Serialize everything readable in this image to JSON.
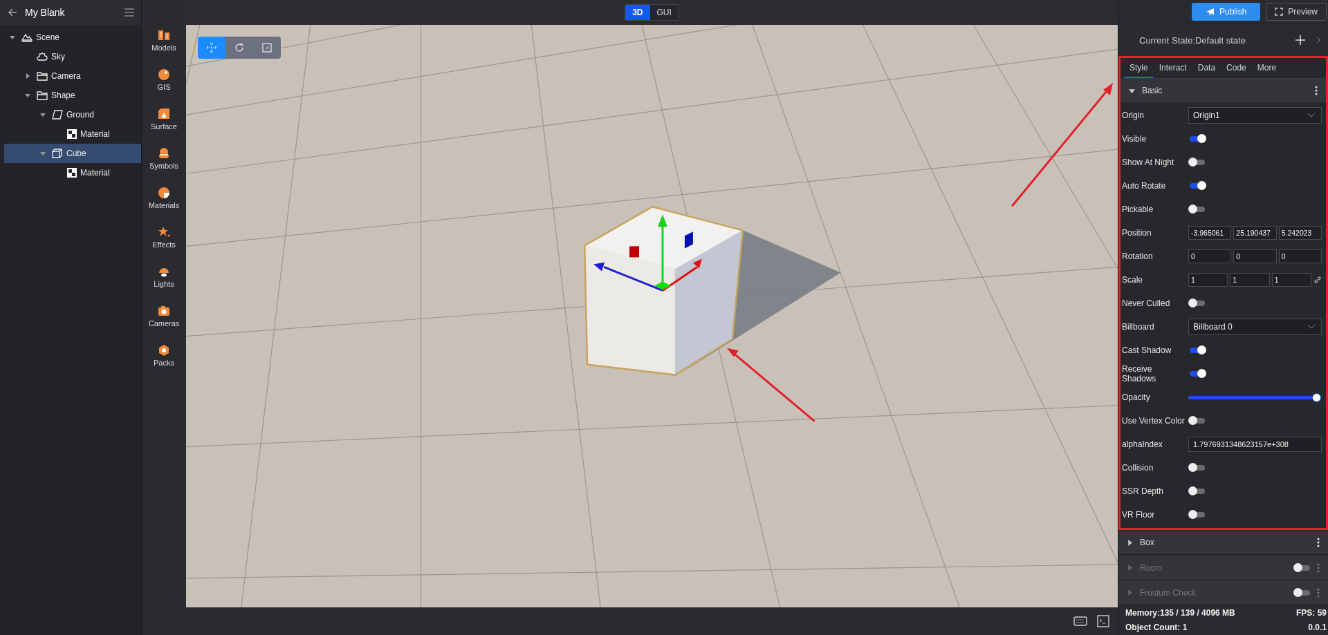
{
  "project": {
    "title": "My Blank"
  },
  "tree": [
    {
      "label": "Scene",
      "kind": "scene",
      "expanded": true,
      "selected": false,
      "children": [
        {
          "label": "Sky",
          "kind": "sky",
          "selected": false
        },
        {
          "label": "Camera",
          "kind": "folder",
          "expanded": false,
          "selected": false
        },
        {
          "label": "Shape",
          "kind": "folder",
          "expanded": true,
          "selected": false,
          "children": [
            {
              "label": "Ground",
              "kind": "plane",
              "expanded": true,
              "selected": false,
              "children": [
                {
                  "label": "Material",
                  "kind": "material",
                  "selected": false
                }
              ]
            },
            {
              "label": "Cube",
              "kind": "box",
              "expanded": true,
              "selected": true,
              "children": [
                {
                  "label": "Material",
                  "kind": "material",
                  "selected": false
                }
              ]
            }
          ]
        }
      ]
    }
  ],
  "library": [
    {
      "label": "Models"
    },
    {
      "label": "GIS"
    },
    {
      "label": "Surface"
    },
    {
      "label": "Symbols"
    },
    {
      "label": "Materials"
    },
    {
      "label": "Effects"
    },
    {
      "label": "Lights"
    },
    {
      "label": "Cameras"
    },
    {
      "label": "Packs"
    }
  ],
  "mode_switch": [
    {
      "label": "3D",
      "selected": true
    },
    {
      "label": "GUI",
      "selected": false
    }
  ],
  "transform_tools": [
    {
      "selected": true
    },
    {
      "selected": false
    },
    {
      "selected": false
    }
  ],
  "header_buttons": [
    {
      "label": "Publish",
      "kind": "primary"
    },
    {
      "label": "Preview",
      "kind": "outline"
    }
  ],
  "state_bar": {
    "text": "Current State:Default state"
  },
  "tabs": [
    {
      "label": "Style",
      "selected": true
    },
    {
      "label": "Interact",
      "selected": false
    },
    {
      "label": "Data",
      "selected": false
    },
    {
      "label": "Code",
      "selected": false
    },
    {
      "label": "More",
      "selected": false
    }
  ],
  "basic": {
    "title": "Basic",
    "expanded": true
  },
  "properties": [
    {
      "kind": "select",
      "label": "Origin",
      "value": "Origin1"
    },
    {
      "kind": "switch",
      "label": "Visible",
      "on": true
    },
    {
      "kind": "switch",
      "label": "Show At Night",
      "on": false
    },
    {
      "kind": "switch",
      "label": "Auto Rotate",
      "on": true
    },
    {
      "kind": "switch",
      "label": "Pickable",
      "on": false
    },
    {
      "kind": "vector",
      "label": "Position",
      "values": [
        "-3.965061",
        "25.190437",
        "5.242023"
      ],
      "linked": false
    },
    {
      "kind": "vector",
      "label": "Rotation",
      "values": [
        "0",
        "0",
        "0"
      ],
      "linked": false
    },
    {
      "kind": "vector",
      "label": "Scale",
      "values": [
        "1",
        "1",
        "1"
      ],
      "linked": true
    },
    {
      "kind": "switch",
      "label": "Never Culled",
      "on": false
    },
    {
      "kind": "select",
      "label": "Billboard",
      "value": "Billboard 0"
    },
    {
      "kind": "switch",
      "label": "Cast Shadow",
      "on": true
    },
    {
      "kind": "switch",
      "label": "Receive Shadows",
      "on": true
    },
    {
      "kind": "slider",
      "label": "Opacity",
      "level": 1
    },
    {
      "kind": "switch",
      "label": "Use Vertex Color",
      "on": false
    },
    {
      "kind": "input",
      "label": "alphaIndex",
      "value": "1.7976931348623157e+308"
    },
    {
      "kind": "switch",
      "label": "Collision",
      "on": false
    },
    {
      "kind": "switch",
      "label": "SSR Depth",
      "on": false
    },
    {
      "kind": "switch",
      "label": "VR Floor",
      "on": false
    }
  ],
  "sections": [
    {
      "title": "Box",
      "expanded": false,
      "disabled": false
    },
    {
      "title": "Room",
      "expanded": false,
      "disabled": true,
      "on": false
    },
    {
      "title": "Frustum Check",
      "expanded": false,
      "disabled": true,
      "on": false
    }
  ],
  "status": {
    "memory": "Memory:135 / 139 / 4096 MB",
    "fps": "FPS: 59",
    "object_count": "Object Count: 1",
    "version": "0.0.1"
  }
}
